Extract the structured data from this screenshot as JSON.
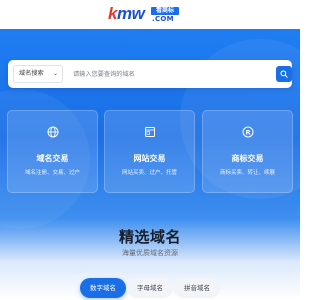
{
  "header": {
    "logo_k": "k",
    "logo_text": "mw",
    "logo_badge": "看商标",
    "logo_com": ".COM"
  },
  "search": {
    "select_label": "域名搜索",
    "placeholder": "请输入您要查询的域名"
  },
  "cards": [
    {
      "title": "域名交易",
      "desc": "域名注册、交易、过户",
      "icon": "globe-icon"
    },
    {
      "title": "网站交易",
      "desc": "网站买卖、过户、托管",
      "icon": "website-icon"
    },
    {
      "title": "商标交易",
      "desc": "商标买卖、转让、续展",
      "icon": "trademark-icon"
    }
  ],
  "section": {
    "title": "精选域名",
    "subtitle": "海量优质域名资源"
  },
  "tabs": [
    {
      "label": "数字域名",
      "active": true
    },
    {
      "label": "字母域名",
      "active": false
    },
    {
      "label": "拼音域名",
      "active": false
    }
  ],
  "colors": {
    "primary": "#1b6fe6",
    "logo_red": "#e23a2f",
    "logo_blue": "#1a4fd8"
  }
}
